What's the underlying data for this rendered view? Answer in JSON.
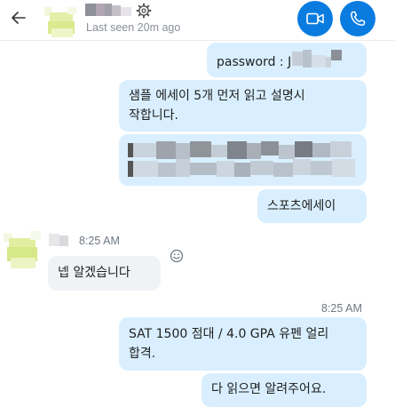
{
  "header": {
    "status": "Last seen 20m ago",
    "icons": {
      "back": "back-arrow-icon",
      "settings": "gear-icon",
      "video": "video-camera-icon",
      "call": "phone-icon"
    },
    "accent_color": "#0a7ce0"
  },
  "messages": [
    {
      "direction": "out",
      "text": "password : J"
    },
    {
      "direction": "out",
      "line1": "샘플 에세이 5개 먼저 읽고 설명시",
      "line2": "작합니다."
    },
    {
      "direction": "out",
      "type": "redacted-link"
    },
    {
      "direction": "out",
      "text": "스포츠에세이"
    },
    {
      "direction": "in",
      "time": "8:25 AM",
      "text": "넵 알겠습니다"
    },
    {
      "direction": "out",
      "time": "8:25 AM",
      "line1": "SAT 1500 점대 / 4.0 GPA 유펜 얼리",
      "line2": "합격."
    },
    {
      "direction": "out",
      "text": "다 읽으면 알려주어요."
    }
  ],
  "colors": {
    "outgoing_bubble": "#d9efff",
    "incoming_bubble": "#f0f3f6"
  }
}
